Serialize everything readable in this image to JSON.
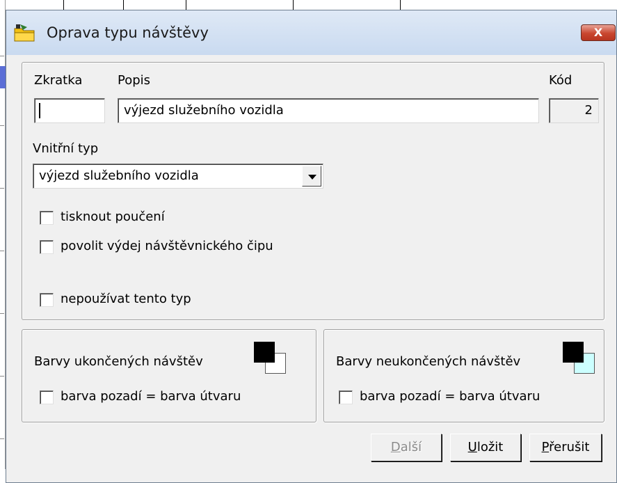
{
  "window": {
    "title": "Oprava typu návštěvy",
    "close_label": "X"
  },
  "main": {
    "zkratka": {
      "label": "Zkratka",
      "value": ""
    },
    "popis": {
      "label": "Popis",
      "value": "výjezd služebního vozidla"
    },
    "kod": {
      "label": "Kód",
      "value": "2"
    },
    "vnitrni_typ": {
      "label": "Vnitřní typ",
      "selected": "výjezd služebního vozidla"
    },
    "checkboxes": {
      "tisknout": {
        "label": "tisknout poučení",
        "checked": false
      },
      "povolit": {
        "label": "povolit výdej návštěvnického čipu",
        "checked": false
      },
      "nepouzivat": {
        "label": "nepoužívat tento typ",
        "checked": false
      }
    }
  },
  "colors": {
    "ukoncene": {
      "label": "Barvy ukončených návštěv",
      "checkbox_label": "barva pozadí = barva útvaru",
      "checked": false,
      "fg": "#000000",
      "bg": "#ffffff"
    },
    "neukoncene": {
      "label": "Barvy neukončených návštěv",
      "checkbox_label": "barva pozadí = barva útvaru",
      "checked": false,
      "fg": "#000000",
      "bg": "#ccffff"
    }
  },
  "buttons": {
    "dalsi": {
      "first": "D",
      "rest": "alší"
    },
    "ulozit": {
      "first": "U",
      "rest": "ložit"
    },
    "prerusit": {
      "first": "P",
      "rest": "řerušit"
    }
  }
}
